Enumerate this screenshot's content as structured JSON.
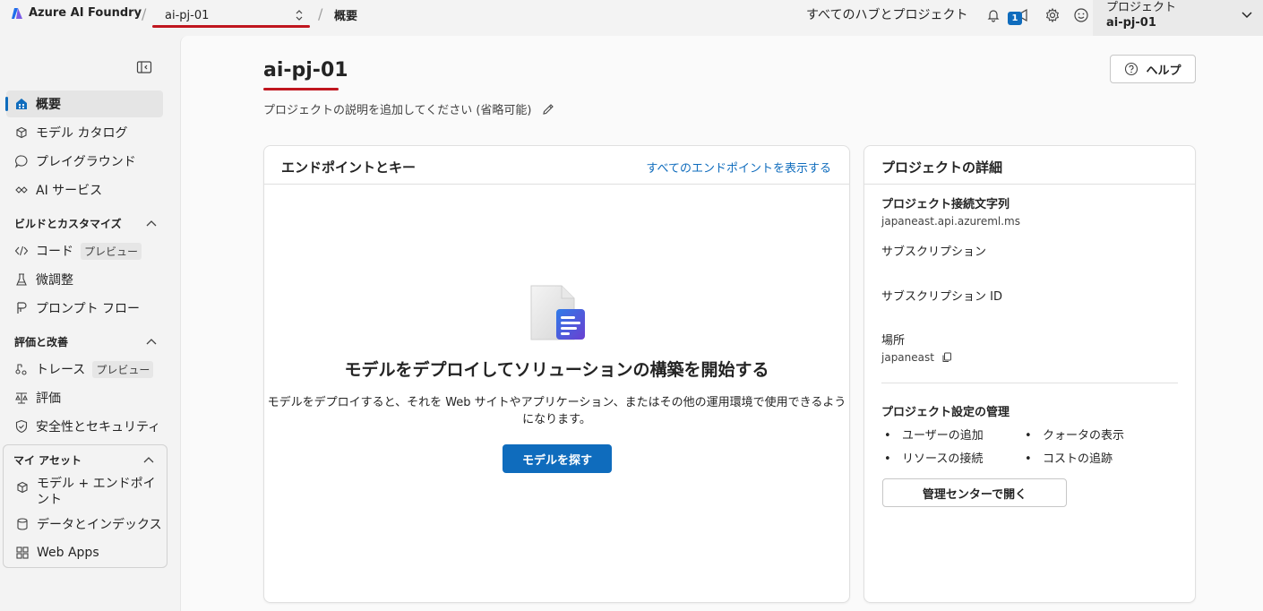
{
  "topbar": {
    "brand": "Azure AI Foundry",
    "project_switcher": "ai-pj-01",
    "breadcrumb_current": "概要",
    "all_hubs_link": "すべてのハブとプロジェクト",
    "notification_count": "1",
    "project_label": "プロジェクト",
    "project_value": "ai-pj-01"
  },
  "sidebar": {
    "items": [
      {
        "label": "概要"
      },
      {
        "label": "モデル カタログ"
      },
      {
        "label": "プレイグラウンド"
      },
      {
        "label": "AI サービス"
      }
    ],
    "section_build": "ビルドとカスタマイズ",
    "build_items": [
      {
        "label": "コード",
        "tag": "プレビュー"
      },
      {
        "label": "微調整"
      },
      {
        "label": "プロンプト フロー"
      }
    ],
    "section_eval": "評価と改善",
    "eval_items": [
      {
        "label": "トレース",
        "tag": "プレビュー"
      },
      {
        "label": "評価"
      },
      {
        "label": "安全性とセキュリティ"
      }
    ],
    "section_assets": "マイ アセット",
    "asset_items": [
      {
        "label": "モデル + エンドポイント"
      },
      {
        "label": "データとインデックス"
      },
      {
        "label": "Web Apps"
      }
    ]
  },
  "main": {
    "title": "ai-pj-01",
    "description": "プロジェクトの説明を追加してください (省略可能)",
    "help_button": "ヘルプ",
    "endpoints_card": {
      "title": "エンドポイントとキー",
      "link": "すべてのエンドポイントを表示する",
      "empty_title": "モデルをデプロイしてソリューションの構築を開始する",
      "empty_desc": "モデルをデプロイすると、それを Web サイトやアプリケーション、またはその他の運用環境で使用できるようになります。",
      "button": "モデルを探す"
    },
    "details_card": {
      "title": "プロジェクトの詳細",
      "conn_label": "プロジェクト接続文字列",
      "conn_value": "japaneast.api.azureml.ms",
      "subscription_label": "サブスクリプション",
      "subscription_id_label": "サブスクリプション ID",
      "location_label": "場所",
      "location_value": "japaneast",
      "settings_title": "プロジェクト設定の管理",
      "settings_items": [
        "ユーザーの追加",
        "クォータの表示",
        "リソースの接続",
        "コストの追跡"
      ],
      "button": "管理センターで開く"
    }
  },
  "colors": {
    "accent": "#0f6cbd",
    "annotation_red": "#c0161f"
  }
}
